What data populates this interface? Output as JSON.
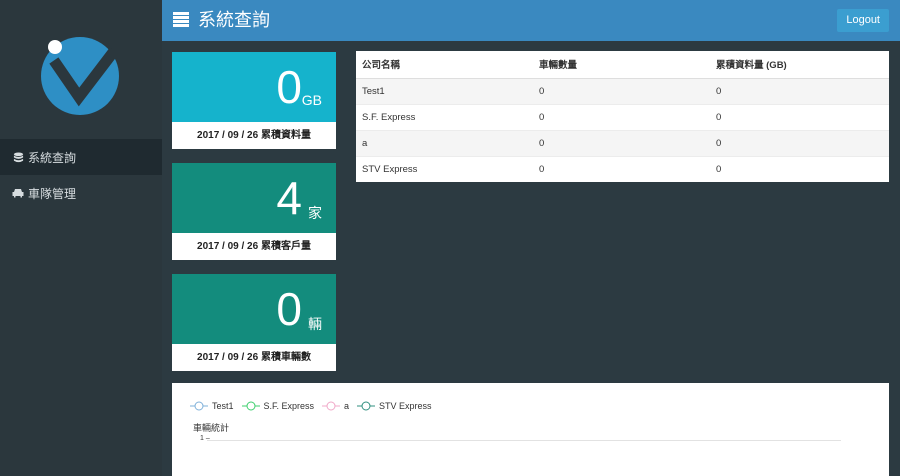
{
  "header": {
    "title": "系統查詢",
    "logout_label": "Logout"
  },
  "sidebar": {
    "items": [
      {
        "label": "系統查詢",
        "icon": "database-icon",
        "active": true
      },
      {
        "label": "車隊管理",
        "icon": "car-icon",
        "active": false
      }
    ]
  },
  "stats": [
    {
      "value": "0",
      "unit": "GB",
      "caption": "2017 / 09 / 26 累積資料量",
      "color": "#15b3cc"
    },
    {
      "value": "4",
      "unit": "家",
      "caption": "2017 / 09 / 26 累積客戶量",
      "color": "#138c7d"
    },
    {
      "value": "0",
      "unit": "輛",
      "caption": "2017 / 09 / 26 累積車輛數",
      "color": "#138c7d"
    }
  ],
  "table": {
    "headers": [
      "公司名稱",
      "車輛數量",
      "累積資料量 (GB)"
    ],
    "rows": [
      [
        "Test1",
        "0",
        "0"
      ],
      [
        "S.F. Express",
        "0",
        "0"
      ],
      [
        "a",
        "0",
        "0"
      ],
      [
        "STV Express",
        "0",
        "0"
      ]
    ]
  },
  "chart": {
    "ylabel": "車輛統計",
    "tick": "1",
    "legend": [
      {
        "name": "Test1",
        "color": "#7eb0d9"
      },
      {
        "name": "S.F. Express",
        "color": "#3ecf6e"
      },
      {
        "name": "a",
        "color": "#f0a8c8"
      },
      {
        "name": "STV Express",
        "color": "#2f8f7f"
      }
    ]
  }
}
